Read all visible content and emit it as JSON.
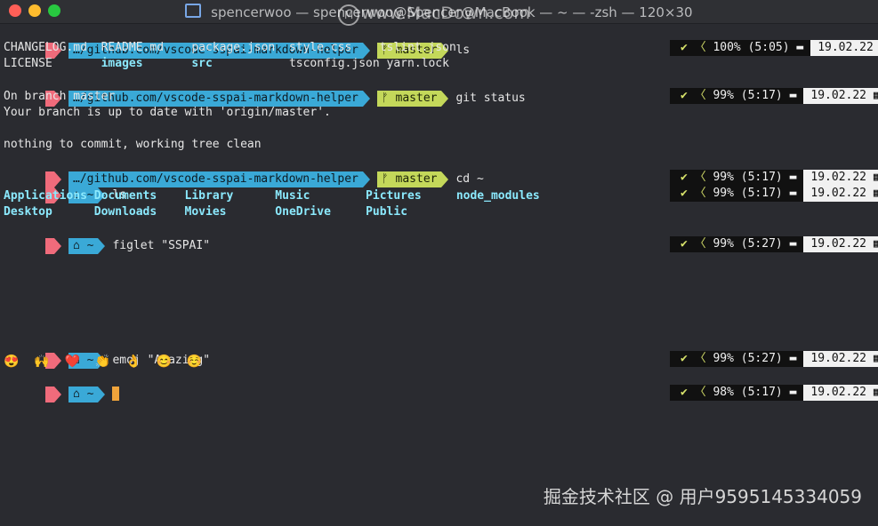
{
  "window": {
    "title": "spencerwoo — spencerwoo@Spencer@MacBook — ~ — -zsh — 120×30",
    "watermark": "www.MacDown.com"
  },
  "prompts": [
    {
      "path": "…/github.com/vscode-sspai-markdown-helper",
      "branch": "master",
      "command": "ls",
      "battery": "100% (5:05)",
      "date": "19.02.22"
    },
    {
      "path": "…/github.com/vscode-sspai-markdown-helper",
      "branch": "master",
      "command": "git status",
      "battery": "99% (5:17)",
      "date": "19.02.22"
    },
    {
      "path": "…/github.com/vscode-sspai-markdown-helper",
      "branch": "master",
      "command": "cd ~",
      "battery": "99% (5:17)",
      "date": "19.02.22"
    },
    {
      "path": "~",
      "branch": "",
      "command": "ls",
      "battery": "99% (5:17)",
      "date": "19.02.22"
    },
    {
      "path": "~",
      "branch": "",
      "command": "figlet \"SSPAI\"",
      "battery": "99% (5:27)",
      "date": "19.02.22"
    },
    {
      "path": "~",
      "branch": "",
      "command": "emoj \"Amazing\"",
      "battery": "99% (5:27)",
      "date": "19.02.22"
    },
    {
      "path": "~",
      "branch": "",
      "command": "",
      "battery": "98% (5:17)",
      "date": "19.02.22"
    }
  ],
  "ls_repo": [
    [
      "CHANGELOG.md",
      "README.md",
      "package.json",
      "style.css",
      "tslint.json"
    ],
    [
      "LICENSE",
      "images",
      "src",
      "tsconfig.json",
      "yarn.lock"
    ]
  ],
  "git_status": [
    "On branch master",
    "Your branch is up to date with 'origin/master'.",
    "",
    "nothing to commit, working tree clean"
  ],
  "ls_home": [
    [
      "Applications",
      "Documents",
      "Library",
      "Music",
      "Pictures",
      "node_modules"
    ],
    [
      "Desktop",
      "Downloads",
      "Movies",
      "OneDrive",
      "Public"
    ]
  ],
  "emoji_output": "😍  🙌  ❤️  👏  👌  😊  ☺️",
  "footer_watermark": "掘金技术社区 @ 用户9595145334059"
}
